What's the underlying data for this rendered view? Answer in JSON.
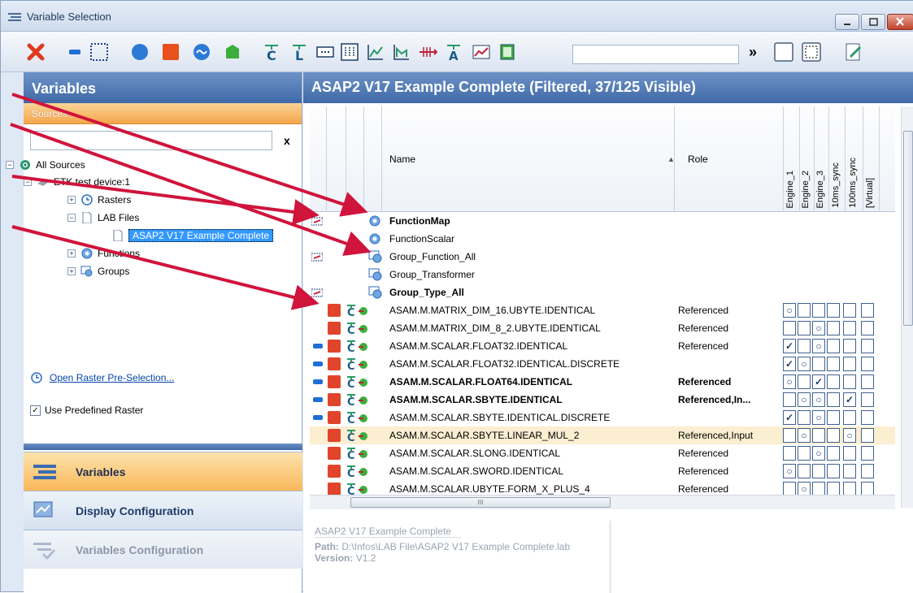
{
  "window": {
    "title": "Variable Selection"
  },
  "toolbar": {
    "search_value": "",
    "overflow": "»"
  },
  "left": {
    "header": "Variables",
    "sources_label": "Sources",
    "search_clear": "x",
    "tree": [
      {
        "label": "All Sources",
        "expander": "−"
      },
      {
        "label": "ETK test device:1",
        "expander": "−"
      },
      {
        "label": "Rasters",
        "expander": "+"
      },
      {
        "label": "LAB Files",
        "expander": "−"
      },
      {
        "label": "ASAP2 V17 Example Complete",
        "expander": ""
      },
      {
        "label": "Functions",
        "expander": "+"
      },
      {
        "label": "Groups",
        "expander": "+"
      }
    ],
    "raster_link": "Open Raster Pre-Selection...",
    "use_predefined": "Use Predefined Raster",
    "use_predefined_checked": "✓",
    "nav": [
      {
        "label": "Variables"
      },
      {
        "label": "Display Configuration"
      },
      {
        "label": "Variables Configuration"
      }
    ]
  },
  "main": {
    "header": "ASAP2 V17 Example Complete (Filtered, 37/125 Visible)",
    "columns": {
      "name": "Name",
      "role": "Role",
      "sort": "▲",
      "rasters": [
        "Engine_1",
        "Engine_2",
        "Engine_3",
        "10ms_sync",
        "100ms_sync",
        "[Virtual]"
      ]
    },
    "rows": [
      {
        "name": "FunctionMap",
        "role": "",
        "bold": true
      },
      {
        "name": "FunctionScalar",
        "role": ""
      },
      {
        "name": "Group_Function_All",
        "role": ""
      },
      {
        "name": "Group_Transformer",
        "role": ""
      },
      {
        "name": "Group_Type_All",
        "role": "",
        "bold": true
      },
      {
        "name": "ASAM.M.MATRIX_DIM_16.UBYTE.IDENTICAL",
        "role": "Referenced"
      },
      {
        "name": "ASAM.M.MATRIX_DIM_8_2.UBYTE.IDENTICAL",
        "role": "Referenced"
      },
      {
        "name": "ASAM.M.SCALAR.FLOAT32.IDENTICAL",
        "role": "Referenced"
      },
      {
        "name": "ASAM.M.SCALAR.FLOAT32.IDENTICAL.DISCRETE",
        "role": ""
      },
      {
        "name": "ASAM.M.SCALAR.FLOAT64.IDENTICAL",
        "role": "Referenced",
        "bold": true
      },
      {
        "name": "ASAM.M.SCALAR.SBYTE.IDENTICAL",
        "role": "Referenced,In...",
        "bold": true
      },
      {
        "name": "ASAM.M.SCALAR.SBYTE.IDENTICAL.DISCRETE",
        "role": ""
      },
      {
        "name": "ASAM.M.SCALAR.SBYTE.LINEAR_MUL_2",
        "role": "Referenced,Input"
      },
      {
        "name": "ASAM.M.SCALAR.SLONG.IDENTICAL",
        "role": "Referenced"
      },
      {
        "name": "ASAM.M.SCALAR.SWORD.IDENTICAL",
        "role": "Referenced"
      },
      {
        "name": "ASAM.M.SCALAR.UBYTE.FORM_X_PLUS_4",
        "role": "Referenced"
      }
    ],
    "scroll_grip": "III",
    "info": {
      "title": "ASAP2 V17 Example Complete",
      "path_label": "Path:",
      "path_value": "D:\\Infos\\LAB File\\ASAP2 V17 Example Complete.lab",
      "version_label": "Version:",
      "version_value": "V1.2"
    }
  },
  "colors": {
    "accent_header": "#3f6aa8",
    "sources_orange": "#f5a64a",
    "arrow_red": "#d0143c",
    "row_red": "#e0452b"
  }
}
